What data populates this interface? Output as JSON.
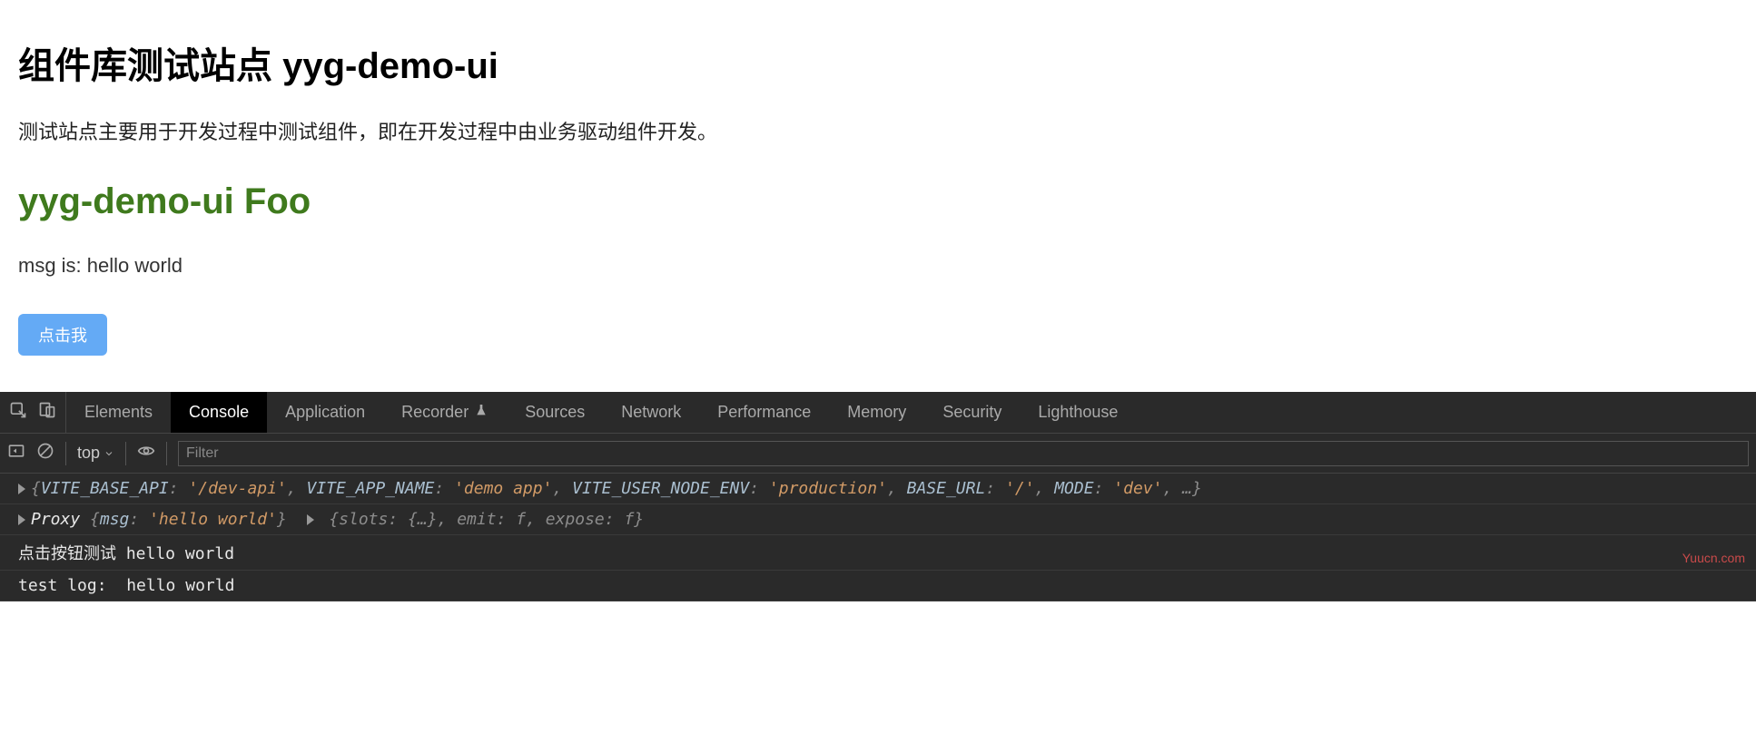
{
  "page": {
    "title": "组件库测试站点 yyg-demo-ui",
    "description": "测试站点主要用于开发过程中测试组件，即在开发过程中由业务驱动组件开发。",
    "subtitle": "yyg-demo-ui Foo",
    "msg_line": "msg is: hello world",
    "button_label": "点击我"
  },
  "devtools": {
    "tabs": [
      "Elements",
      "Console",
      "Application",
      "Recorder",
      "Sources",
      "Network",
      "Performance",
      "Memory",
      "Security",
      "Lighthouse"
    ],
    "active_tab": "Console",
    "top_label": "top",
    "filter_placeholder": "Filter",
    "console": {
      "line1": {
        "prefix": "{",
        "pairs": [
          {
            "k": "VITE_BASE_API",
            "v": "'/dev-api'"
          },
          {
            "k": "VITE_APP_NAME",
            "v": "'demo app'"
          },
          {
            "k": "VITE_USER_NODE_ENV",
            "v": "'production'"
          },
          {
            "k": "BASE_URL",
            "v": "'/'"
          },
          {
            "k": "MODE",
            "v": "'dev'"
          }
        ],
        "suffix": ", …}"
      },
      "line2_a": "Proxy ",
      "line2_b_open": "{",
      "line2_b_key": "msg",
      "line2_b_val": "'hello world'",
      "line2_b_close": "}",
      "line2_c": " {slots: {…}, emit: f, expose: f}",
      "line3": "点击按钮测试 hello world",
      "line4": "test log:  hello world"
    },
    "watermark": "Yuucn.com"
  }
}
